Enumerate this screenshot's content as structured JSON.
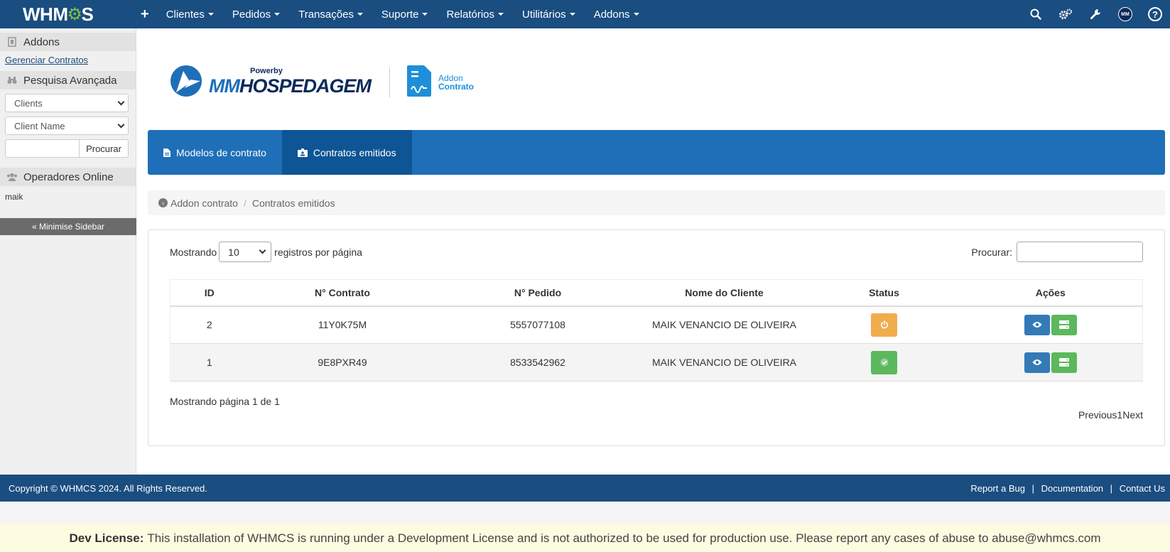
{
  "app": {
    "logo": "WHMCS"
  },
  "topnav": {
    "plus": "+",
    "items": [
      "Clientes",
      "Pedidos",
      "Transações",
      "Suporte",
      "Relatórios",
      "Utilitários",
      "Addons"
    ],
    "avatar_initials": "MM",
    "help": "?"
  },
  "sidebar": {
    "addons_title": "Addons",
    "addons_link": "Gerenciar Contratos",
    "search_title": "Pesquisa Avançada",
    "select_type": "Clients",
    "select_field": "Client Name",
    "search_button": "Procurar",
    "operators_title": "Operadores Online",
    "operator": "maik",
    "minimise": "« Minimise Sidebar"
  },
  "brand": {
    "powerby": "Powerby",
    "name_a": "MM",
    "name_b": "HOSPEDAGEM",
    "addon_line1": "Addon",
    "addon_line2": "Contrato"
  },
  "tabs": [
    {
      "label": "Modelos de contrato",
      "icon": "file-icon"
    },
    {
      "label": "Contratos emitidos",
      "icon": "id-badge-icon",
      "active": true
    }
  ],
  "breadcrumb": {
    "root": "Addon contrato",
    "current": "Contratos emitidos"
  },
  "table_controls": {
    "show_label": "Mostrando",
    "page_length": "10",
    "per_page_label": "registros por página",
    "search_label": "Procurar:"
  },
  "table": {
    "headers": [
      "ID",
      "N° Contrato",
      "N° Pedido",
      "Nome do Cliente",
      "Status",
      "Ações"
    ],
    "rows": [
      {
        "id": "2",
        "contract": "11Y0K75M",
        "order": "5557077108",
        "client": "MAIK VENANCIO DE OLIVEIRA",
        "status": "pending"
      },
      {
        "id": "1",
        "contract": "9E8PXR49",
        "order": "8533542962",
        "client": "MAIK VENANCIO DE OLIVEIRA",
        "status": "signed"
      }
    ]
  },
  "pagination": {
    "info": "Mostrando página 1 de 1",
    "prev": "Previous",
    "page": "1",
    "next": "Next"
  },
  "footer": {
    "copyright": "Copyright © WHMCS 2024. All Rights Reserved.",
    "report": "Report a Bug",
    "docs": "Documentation",
    "contact": "Contact Us",
    "sep": "|"
  },
  "license": {
    "label": "Dev License:",
    "text": "This installation of WHMCS is running under a Development License and is not authorized to be used for production use. Please report any cases of abuse to abuse@whmcs.com"
  },
  "colors": {
    "nav": "#1a4d80",
    "tab_bar": "#1e6fb8",
    "tab_active": "#0d5594",
    "warning": "#f0ad4e",
    "success": "#5cb85c",
    "primary": "#337ab7"
  }
}
